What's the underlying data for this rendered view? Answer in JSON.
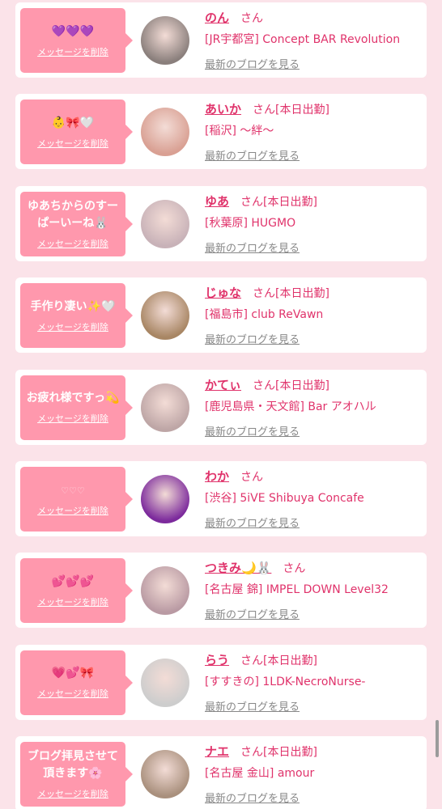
{
  "delete_label": "メッセージを削除",
  "honorific": "さん",
  "blog_label": "最新のブログを見る",
  "colors": {
    "background": "#fbe3e9",
    "bubble": "#ff98ad",
    "accent": "#e0336b",
    "muted": "#888888"
  },
  "items": [
    {
      "message": "💜💜💜",
      "name": "のん",
      "status": "",
      "shop": "[JR宇都宮] Concept BAR Revolution",
      "avatar_color": "#8a7f7c"
    },
    {
      "message": "👶🎀🤍",
      "name": "あいか",
      "status": "[本日出勤]",
      "shop": "[稲沢] 〜絆〜",
      "avatar_color": "#d9a093"
    },
    {
      "message": "ゆあちからのすーぱーいーね🐰",
      "name": "ゆあ",
      "status": "[本日出勤]",
      "shop": "[秋葉原] HUGMO",
      "avatar_color": "#c8b2b8"
    },
    {
      "message": "手作り凄い✨🤍",
      "name": "じゅな",
      "status": "[本日出勤]",
      "shop": "[福島市] club ReVawn",
      "avatar_color": "#a88664"
    },
    {
      "message": "お疲れ様ですっ💫",
      "name": "かてぃ",
      "status": "[本日出勤]",
      "shop": "[鹿児島県・天文館] Bar アオハル",
      "avatar_color": "#bea6a6"
    },
    {
      "message": "♡♡♡",
      "name": "わか",
      "status": "",
      "shop": "[渋谷] 5iVE Shibuya Concafe",
      "avatar_color": "#7c2a9c"
    },
    {
      "message": "💕💕💕",
      "name": "つきみ🌙🐰",
      "status": "",
      "shop": "[名古屋 錦] IMPEL DOWN Level32",
      "avatar_color": "#b99aa3"
    },
    {
      "message": "💗💕🎀",
      "name": "らう",
      "status": "[本日出勤]",
      "shop": "[すすきの] 1LDK-NecroNurse-",
      "avatar_color": "#cdcdcd"
    },
    {
      "message": "ブログ拝見させて頂きます🌸",
      "name": "ナエ",
      "status": "[本日出勤]",
      "shop": "[名古屋 金山] amour",
      "avatar_color": "#a9907d"
    }
  ]
}
